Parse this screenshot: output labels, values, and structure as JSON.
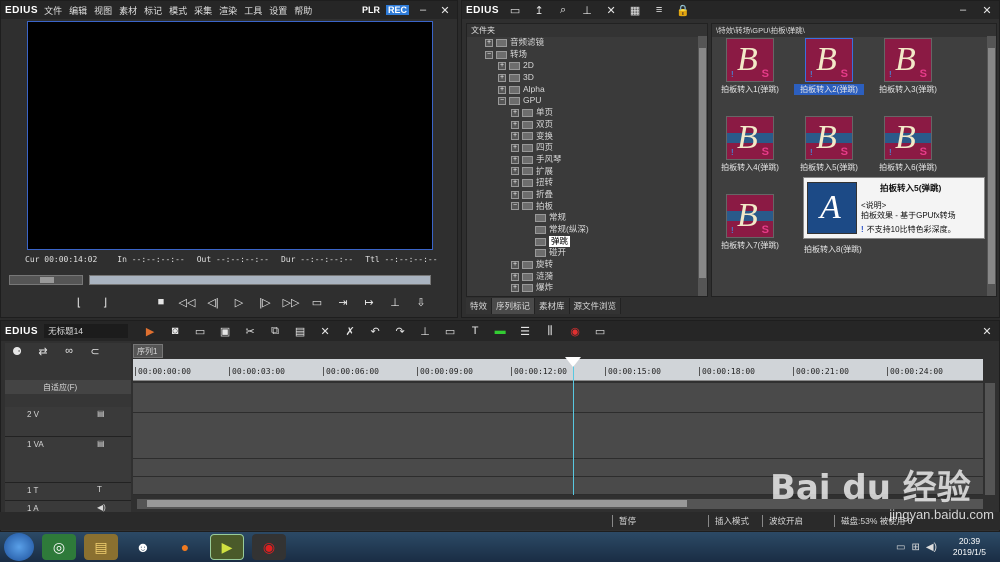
{
  "player": {
    "logo": "EDIUS",
    "menu": [
      "文件",
      "编辑",
      "视图",
      "素材",
      "标记",
      "模式",
      "采集",
      "渲染",
      "工具",
      "设置",
      "帮助"
    ],
    "plr": "PLR",
    "rec": "REC",
    "timecodes": {
      "cur_label": "Cur",
      "cur": "00:00:14:02",
      "in_label": "In",
      "in": "--:--:--:--",
      "out_label": "Out",
      "out": "--:--:--:--",
      "dur_label": "Dur",
      "dur": "--:--:--:--",
      "ttl_label": "Ttl",
      "ttl": "--:--:--:--"
    }
  },
  "library": {
    "logo": "EDIUS",
    "tree_header": "文件夹",
    "path": "\\特效\\转场\\GPU\\拍板\\弹跳\\",
    "tree": [
      {
        "label": "音频滤镜",
        "indent": 2,
        "type": "fold"
      },
      {
        "label": "转场",
        "indent": 2,
        "type": "fold-open"
      },
      {
        "label": "2D",
        "indent": 3,
        "type": "fold"
      },
      {
        "label": "3D",
        "indent": 3,
        "type": "fold"
      },
      {
        "label": "Alpha",
        "indent": 3,
        "type": "fold"
      },
      {
        "label": "GPU",
        "indent": 3,
        "type": "fold-open"
      },
      {
        "label": "单页",
        "indent": 4,
        "type": "fold"
      },
      {
        "label": "双页",
        "indent": 4,
        "type": "fold"
      },
      {
        "label": "变换",
        "indent": 4,
        "type": "fold"
      },
      {
        "label": "四页",
        "indent": 4,
        "type": "fold"
      },
      {
        "label": "手风琴",
        "indent": 4,
        "type": "fold"
      },
      {
        "label": "扩展",
        "indent": 4,
        "type": "fold"
      },
      {
        "label": "扭转",
        "indent": 4,
        "type": "fold"
      },
      {
        "label": "折叠",
        "indent": 4,
        "type": "fold"
      },
      {
        "label": "拍板",
        "indent": 4,
        "type": "fold-open"
      },
      {
        "label": "常规",
        "indent": 5,
        "type": "leaf"
      },
      {
        "label": "常规(纵深)",
        "indent": 5,
        "type": "leaf"
      },
      {
        "label": "弹跳",
        "indent": 5,
        "type": "leaf-selected"
      },
      {
        "label": "碰开",
        "indent": 5,
        "type": "leaf"
      },
      {
        "label": "旋转",
        "indent": 4,
        "type": "fold"
      },
      {
        "label": "涟漪",
        "indent": 4,
        "type": "fold"
      },
      {
        "label": "爆炸",
        "indent": 4,
        "type": "fold"
      }
    ],
    "tabs": [
      "特效",
      "序列标记",
      "素材库",
      "源文件浏览"
    ],
    "items": [
      {
        "label": "拍板转入1(弹跳)"
      },
      {
        "label": "拍板转入2(弹跳)"
      },
      {
        "label": "拍板转入3(弹跳)"
      },
      {
        "label": "拍板转入4(弹跳)"
      },
      {
        "label": "拍板转入5(弹跳)"
      },
      {
        "label": "拍板转入6(弹跳)"
      },
      {
        "label": "拍板转入7(弹跳)"
      },
      {
        "label": "拍板转入8(弹跳)"
      }
    ],
    "tooltip": {
      "title": "拍板转入5(弹跳)",
      "heading": "<说明>",
      "desc": "拍板效果 - 基于GPUfx转场",
      "warning": "不支持10比特色彩深度。"
    }
  },
  "timeline": {
    "logo": "EDIUS",
    "project": "无标题14",
    "sequence_tab": "序列1",
    "mode": "自适应(F)",
    "ruler": [
      "00:00:00:00",
      "00:00:03:00",
      "00:00:06:00",
      "00:00:09:00",
      "00:00:12:00",
      "00:00:15:00",
      "00:00:18:00",
      "00:00:21:00",
      "00:00:24:00"
    ],
    "tracks": [
      {
        "name": "2 V",
        "kind": "video"
      },
      {
        "name": "1 VA",
        "kind": "videoaudio"
      },
      {
        "name": "1 T",
        "kind": "title"
      },
      {
        "name": "1 A",
        "kind": "audio"
      }
    ]
  },
  "status": {
    "items": [
      "暂停",
      "插入模式",
      "波纹开启",
      "磁盘:53% 被使用 0"
    ]
  },
  "watermark": {
    "text": "Bai du 经验",
    "url": "jingyan.baidu.com"
  },
  "taskbar": {
    "time": "20:39",
    "date": "2019/1/5"
  }
}
